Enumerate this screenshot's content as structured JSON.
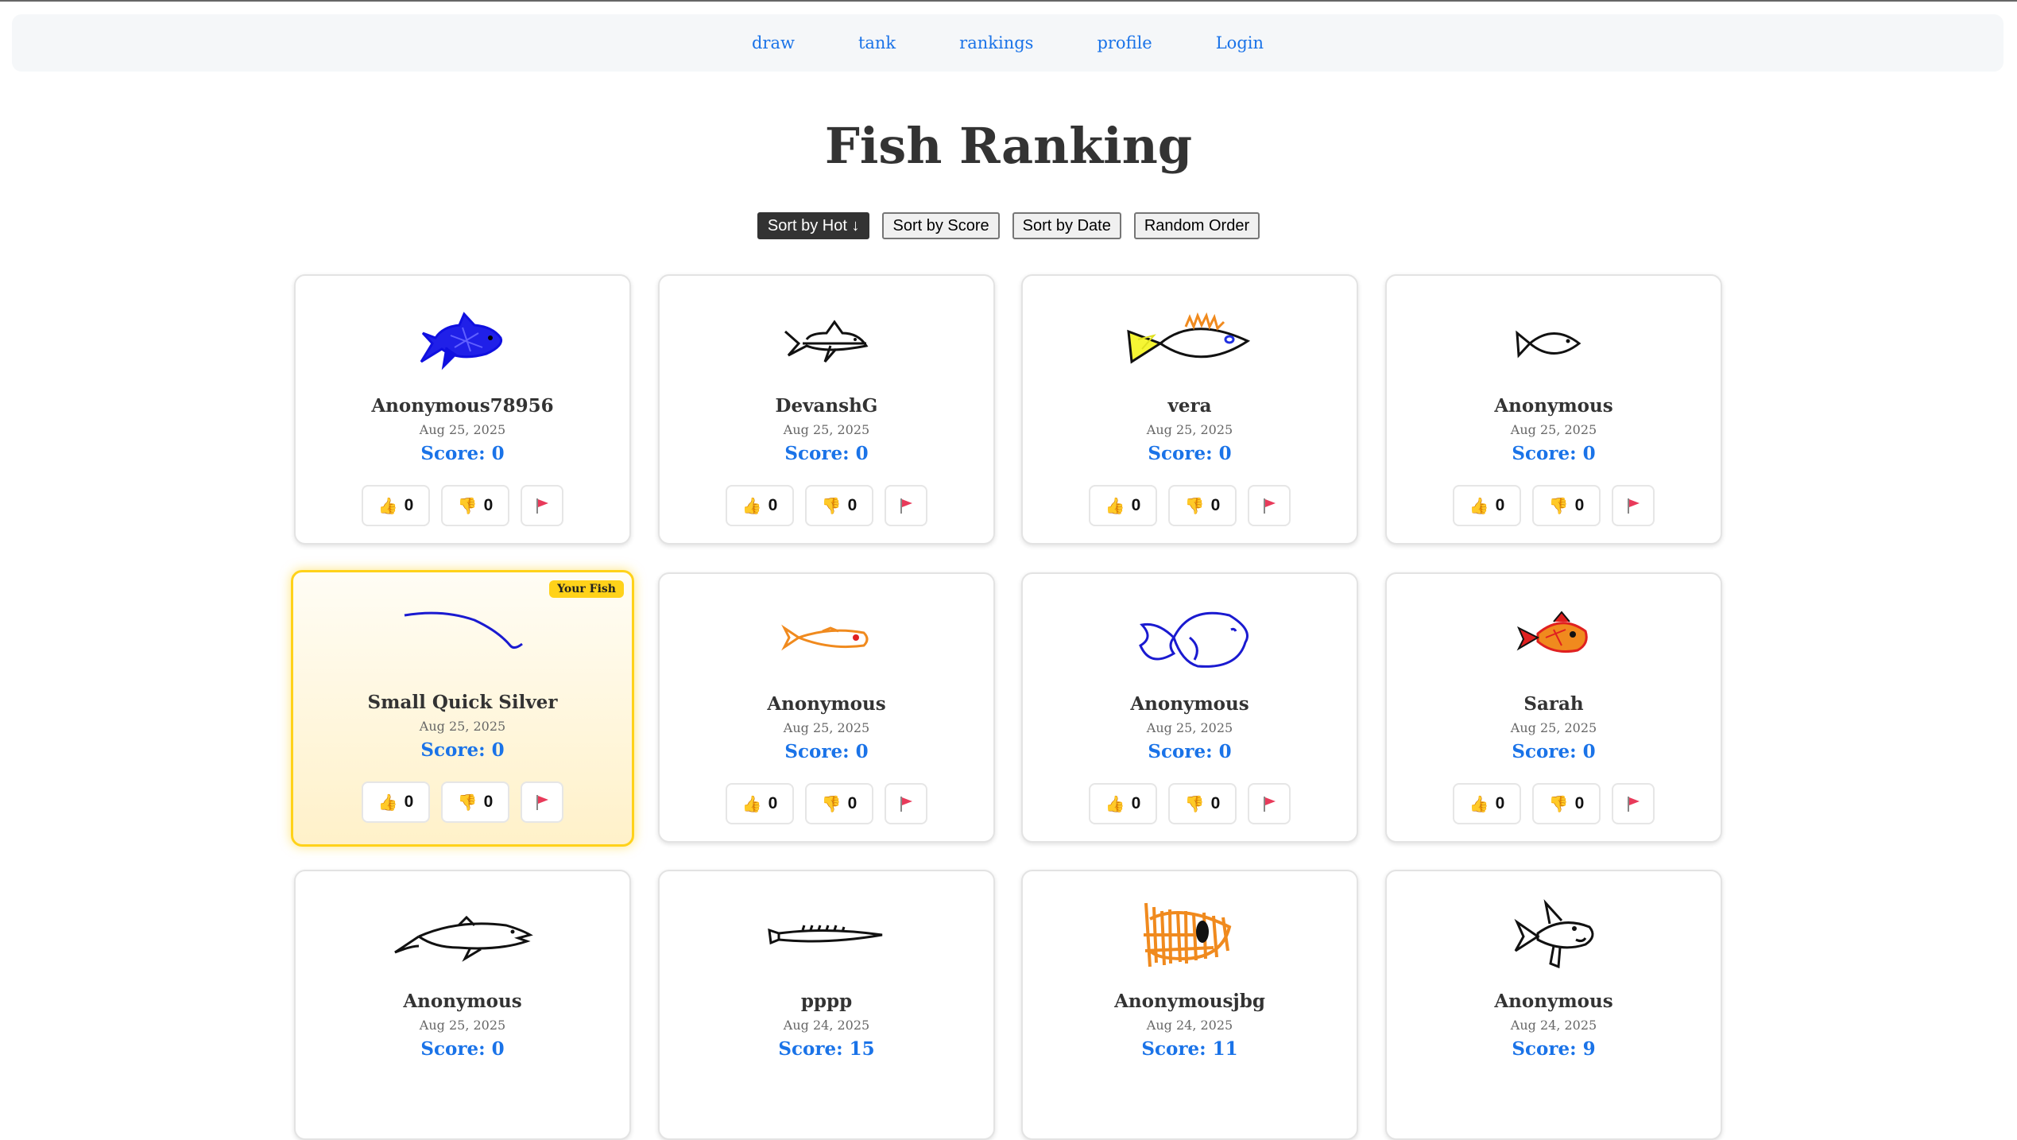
{
  "nav": {
    "items": [
      {
        "label": "draw"
      },
      {
        "label": "tank"
      },
      {
        "label": "rankings"
      },
      {
        "label": "profile"
      },
      {
        "label": "Login"
      }
    ]
  },
  "page_title": "Fish Ranking",
  "sort_buttons": [
    {
      "label": "Sort by Hot ↓",
      "active": true
    },
    {
      "label": "Sort by Score",
      "active": false
    },
    {
      "label": "Sort by Date",
      "active": false
    },
    {
      "label": "Random Order",
      "active": false
    }
  ],
  "badge_label": "Your Fish",
  "icons": {
    "upvote": "thumbs-up-icon",
    "downvote": "thumbs-down-icon",
    "report": "flag-icon"
  },
  "fish": [
    {
      "artist": "Anonymous78956",
      "date": "Aug 25, 2025",
      "score": "Score: 0",
      "upvotes": "0",
      "downvotes": "0",
      "mine": false,
      "color": "#1010e0"
    },
    {
      "artist": "DevanshG",
      "date": "Aug 25, 2025",
      "score": "Score: 0",
      "upvotes": "0",
      "downvotes": "0",
      "mine": false,
      "color": "#111111"
    },
    {
      "artist": "vera",
      "date": "Aug 25, 2025",
      "score": "Score: 0",
      "upvotes": "0",
      "downvotes": "0",
      "mine": false,
      "color": "#111111"
    },
    {
      "artist": "Anonymous",
      "date": "Aug 25, 2025",
      "score": "Score: 0",
      "upvotes": "0",
      "downvotes": "0",
      "mine": false,
      "color": "#111111"
    },
    {
      "artist": "Small Quick Silver",
      "date": "Aug 25, 2025",
      "score": "Score: 0",
      "upvotes": "0",
      "downvotes": "0",
      "mine": true,
      "color": "#1a1ad0"
    },
    {
      "artist": "Anonymous",
      "date": "Aug 25, 2025",
      "score": "Score: 0",
      "upvotes": "0",
      "downvotes": "0",
      "mine": false,
      "color": "#f08a1e"
    },
    {
      "artist": "Anonymous",
      "date": "Aug 25, 2025",
      "score": "Score: 0",
      "upvotes": "0",
      "downvotes": "0",
      "mine": false,
      "color": "#1a1ad0"
    },
    {
      "artist": "Sarah",
      "date": "Aug 25, 2025",
      "score": "Score: 0",
      "upvotes": "0",
      "downvotes": "0",
      "mine": false,
      "color": "#e03010"
    },
    {
      "artist": "Anonymous",
      "date": "Aug 25, 2025",
      "score": "Score: 0",
      "upvotes": "",
      "downvotes": "",
      "mine": false,
      "color": "#111111"
    },
    {
      "artist": "pppp",
      "date": "Aug 24, 2025",
      "score": "Score: 15",
      "upvotes": "",
      "downvotes": "",
      "mine": false,
      "color": "#111111"
    },
    {
      "artist": "Anonymousjbg",
      "date": "Aug 24, 2025",
      "score": "Score: 11",
      "upvotes": "",
      "downvotes": "",
      "mine": false,
      "color": "#f08a1e"
    },
    {
      "artist": "Anonymous",
      "date": "Aug 24, 2025",
      "score": "Score: 9",
      "upvotes": "",
      "downvotes": "",
      "mine": false,
      "color": "#111111"
    }
  ]
}
